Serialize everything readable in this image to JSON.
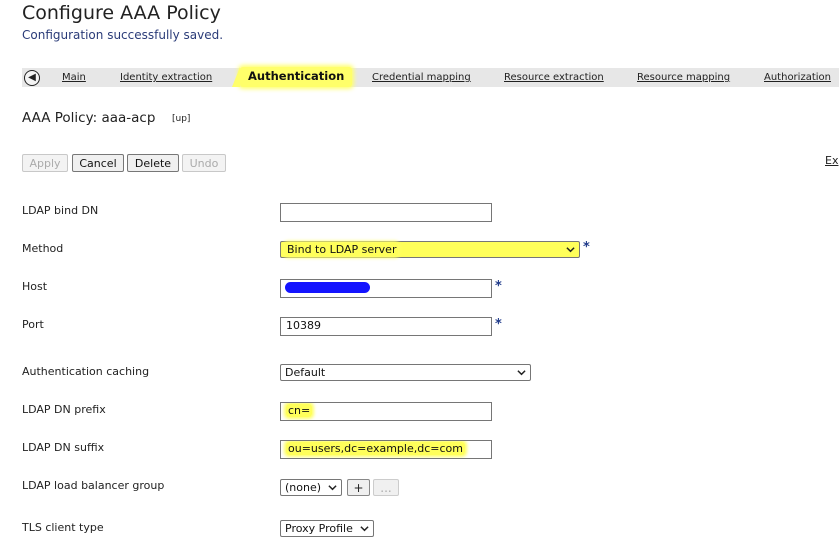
{
  "page": {
    "title": "Configure AAA Policy",
    "status_message": "Configuration successfully saved."
  },
  "tabs": {
    "main": "Main",
    "identity_extraction": "Identity extraction",
    "authentication": "Authentication",
    "credential_mapping": "Credential mapping",
    "resource_extraction": "Resource extraction",
    "resource_mapping": "Resource mapping",
    "authorization": "Authorization",
    "active": "Authentication"
  },
  "policy": {
    "label": "AAA Policy: aaa-acp",
    "state": "[up]"
  },
  "toolbar": {
    "apply": "Apply",
    "cancel": "Cancel",
    "delete": "Delete",
    "undo": "Undo",
    "ex_link": "Ex"
  },
  "form": {
    "ldap_bind_dn": {
      "label": "LDAP bind DN",
      "value": ""
    },
    "method": {
      "label": "Method",
      "value": "Bind to LDAP server"
    },
    "host": {
      "label": "Host",
      "value": ""
    },
    "port": {
      "label": "Port",
      "value": "10389"
    },
    "auth_caching": {
      "label": "Authentication caching",
      "value": "Default"
    },
    "dn_prefix": {
      "label": "LDAP DN prefix",
      "value": "cn="
    },
    "dn_suffix": {
      "label": "LDAP DN suffix",
      "value": "ou=users,dc=example,dc=com"
    },
    "lb_group": {
      "label": "LDAP load balancer group",
      "value": "(none)",
      "add": "+",
      "more": "..."
    },
    "tls_client_type": {
      "label": "TLS client type",
      "value": "Proxy Profile"
    },
    "required_marker": "*"
  },
  "colors": {
    "highlight": "#ffff5a",
    "status_text": "#2a3b78",
    "required": "#1f3a8a",
    "redaction": "#1414ff"
  },
  "icons": {
    "back": "back-arrow-circle-icon",
    "dropdown": "chevron-down-icon"
  }
}
